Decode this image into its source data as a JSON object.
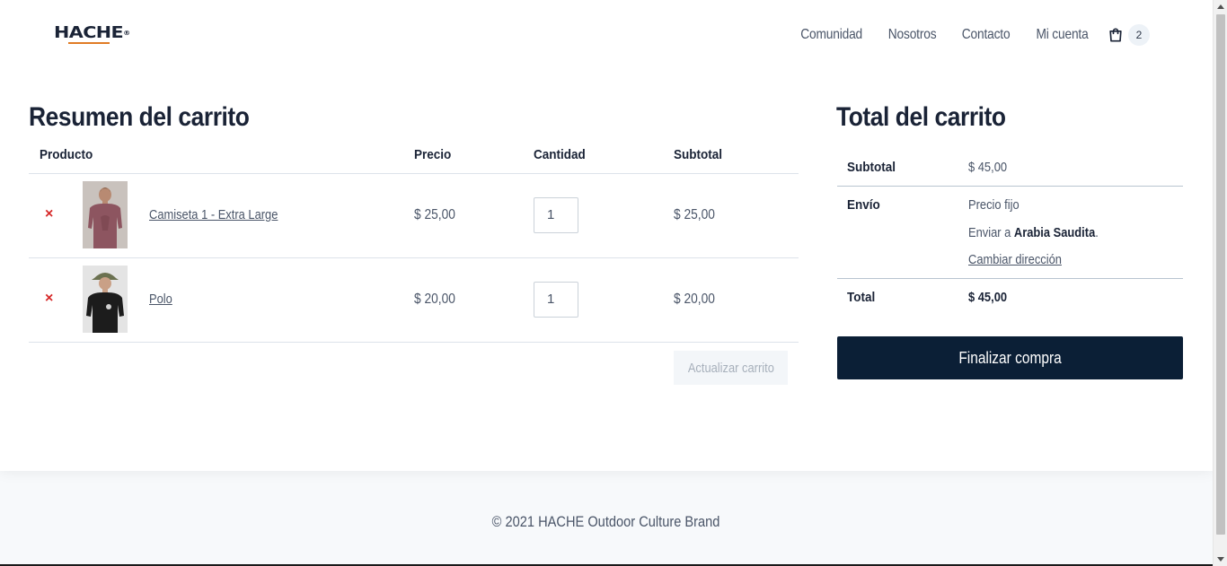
{
  "brand": {
    "logo_text": "HACHE",
    "logo_mark": "®"
  },
  "nav": {
    "items": [
      "Comunidad",
      "Nosotros",
      "Contacto",
      "Mi cuenta"
    ],
    "cart_count": "2"
  },
  "cart": {
    "title": "Resumen del carrito",
    "headers": {
      "product": "Producto",
      "price": "Precio",
      "quantity": "Cantidad",
      "subtotal": "Subtotal"
    },
    "remove_symbol": "×",
    "items": [
      {
        "name": "Camiseta 1 - Extra Large",
        "price": "$ 25,00",
        "quantity": "1",
        "subtotal": "$ 25,00"
      },
      {
        "name": "Polo",
        "price": "$ 20,00",
        "quantity": "1",
        "subtotal": "$ 20,00"
      }
    ],
    "update_label": "Actualizar carrito"
  },
  "totals": {
    "title": "Total del carrito",
    "subtotal_label": "Subtotal",
    "subtotal_value": "$ 45,00",
    "shipping_label": "Envío",
    "shipping_method": "Precio fijo",
    "ship_to_prefix": "Enviar a",
    "ship_to_country": "Arabia Saudita",
    "ship_to_suffix": ".",
    "change_address": "Cambiar dirección",
    "total_label": "Total",
    "total_value": "$ 45,00",
    "checkout_label": "Finalizar compra"
  },
  "footer": {
    "text": "© 2021 HACHE Outdoor Culture Brand"
  },
  "colors": {
    "primary": "#0b1f36",
    "heading": "#1a2336",
    "remove": "#d62828",
    "logo_accent": "#e07b24"
  }
}
